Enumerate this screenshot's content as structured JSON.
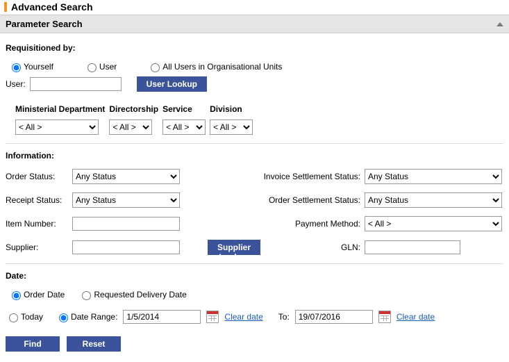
{
  "page": {
    "title": "Advanced Search",
    "section_header": "Parameter Search"
  },
  "requisitioned": {
    "group_label": "Requisitioned by:",
    "options": {
      "yourself": "Yourself",
      "user": "User",
      "allunits": "All Users in Organisational Units"
    },
    "user_label": "User:",
    "user_value": "",
    "user_lookup_btn": "User Lookup"
  },
  "org": {
    "columns": {
      "ministerial": {
        "head": "Ministerial Department",
        "value": "< All >"
      },
      "directorship": {
        "head": "Directorship",
        "value": "< All >"
      },
      "service": {
        "head": "Service",
        "value": "< All >"
      },
      "division": {
        "head": "Division",
        "value": "< All >"
      }
    }
  },
  "information": {
    "group_label": "Information:",
    "labels": {
      "order_status": "Order Status:",
      "receipt_status": "Receipt Status:",
      "item_number": "Item Number:",
      "supplier": "Supplier:",
      "invoice_settlement_status": "Invoice Settlement Status:",
      "order_settlement_status": "Order Settlement Status:",
      "payment_method": "Payment Method:",
      "gln": "GLN:"
    },
    "values": {
      "order_status": "Any Status",
      "receipt_status": "Any Status",
      "invoice_settlement_status": "Any Status",
      "order_settlement_status": "Any Status",
      "payment_method": "< All >",
      "item_number": "",
      "supplier": "",
      "gln": ""
    },
    "supplier_lookup_btn": "Supplier Lookup"
  },
  "date": {
    "group_label": "Date:",
    "options": {
      "order_date": "Order Date",
      "requested_delivery": "Requested Delivery Date",
      "today": "Today",
      "date_range": "Date Range:"
    },
    "from_value": "1/5/2014",
    "to_label": "To:",
    "to_value": "19/07/2016",
    "clear_date": "Clear date"
  },
  "actions": {
    "find": "Find",
    "reset": "Reset"
  }
}
